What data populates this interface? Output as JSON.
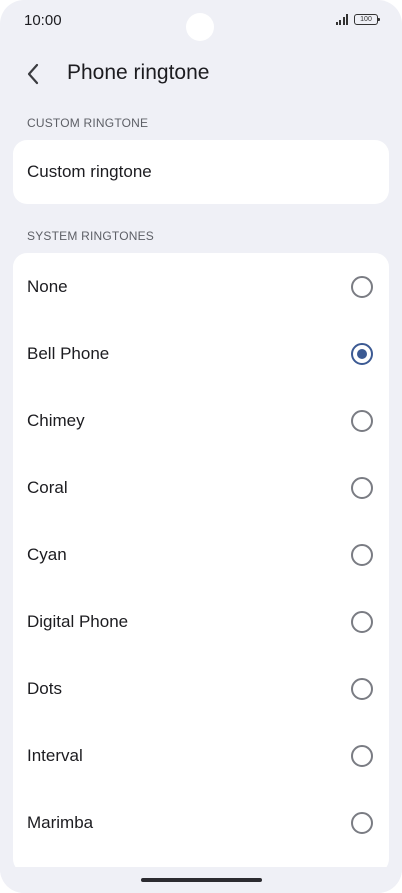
{
  "status_bar": {
    "time": "10:00",
    "battery": "100"
  },
  "header": {
    "title": "Phone ringtone",
    "back_icon": "chevron-left-icon"
  },
  "custom_section": {
    "header": "CUSTOM RINGTONE",
    "item_label": "Custom ringtone"
  },
  "system_section": {
    "header": "SYSTEM RINGTONES",
    "items": [
      {
        "label": "None",
        "selected": false
      },
      {
        "label": "Bell Phone",
        "selected": true
      },
      {
        "label": "Chimey",
        "selected": false
      },
      {
        "label": "Coral",
        "selected": false
      },
      {
        "label": "Cyan",
        "selected": false
      },
      {
        "label": "Digital Phone",
        "selected": false
      },
      {
        "label": "Dots",
        "selected": false
      },
      {
        "label": "Interval",
        "selected": false
      },
      {
        "label": "Marimba",
        "selected": false
      }
    ]
  },
  "colors": {
    "accent": "#3c5a93",
    "background": "#eff0f6",
    "card": "#ffffff"
  }
}
